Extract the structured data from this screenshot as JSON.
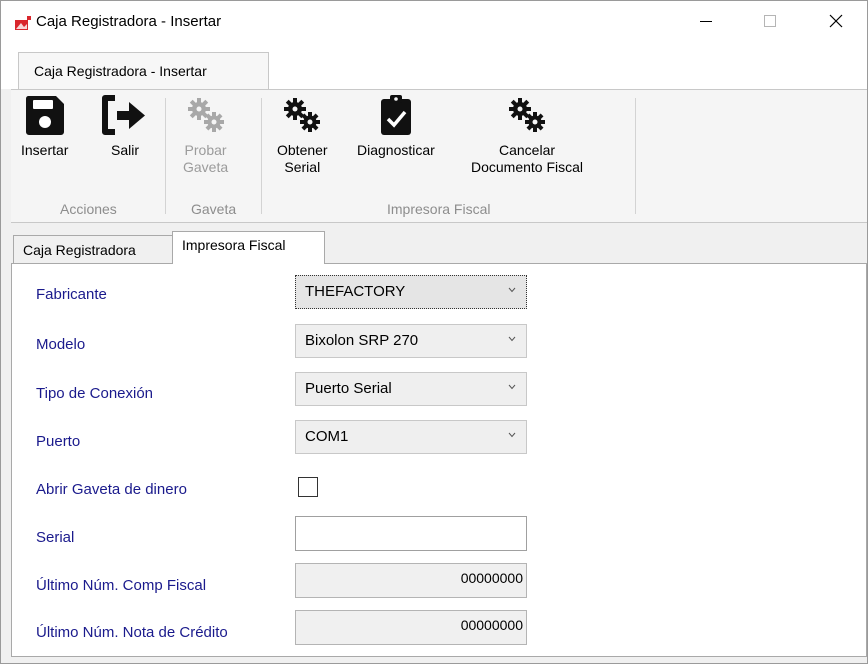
{
  "window": {
    "title": "Caja Registradora - Insertar",
    "controls": {
      "minimize_icon": "minimize-icon",
      "maximize_icon": "maximize-icon",
      "close_icon": "close-icon"
    }
  },
  "ribbon": {
    "tab_label": "Caja Registradora - Insertar",
    "buttons": [
      {
        "label": "Insertar",
        "icon": "save-icon",
        "enabled": true
      },
      {
        "label": "Salir",
        "icon": "exit-icon",
        "enabled": true
      },
      {
        "label_line1": "Probar",
        "label_line2": "Gaveta",
        "icon": "gears-icon",
        "enabled": false
      },
      {
        "label_line1": "Obtener",
        "label_line2": "Serial",
        "icon": "gears-icon",
        "enabled": true
      },
      {
        "label": "Diagnosticar",
        "icon": "clipboard-check-icon",
        "enabled": true
      },
      {
        "label_line1": "Cancelar",
        "label_line2": "Documento Fiscal",
        "icon": "gears-icon",
        "enabled": true
      }
    ],
    "groups": {
      "acciones": "Acciones",
      "gaveta": "Gaveta",
      "impresora": "Impresora Fiscal"
    }
  },
  "tabs": {
    "caja": "Caja Registradora",
    "impresora": "Impresora Fiscal",
    "active": "Impresora Fiscal"
  },
  "form": {
    "fabricante": {
      "label": "Fabricante",
      "value": "THEFACTORY"
    },
    "modelo": {
      "label": "Modelo",
      "value": "Bixolon SRP 270"
    },
    "tipo_conexion": {
      "label": "Tipo de Conexión",
      "value": "Puerto Serial"
    },
    "puerto": {
      "label": "Puerto",
      "value": "COM1"
    },
    "abrir_gaveta": {
      "label": "Abrir Gaveta de dinero",
      "checked": false
    },
    "serial": {
      "label": "Serial",
      "value": ""
    },
    "ultimo_comp": {
      "label": "Último Núm. Comp Fiscal",
      "value": "00000000"
    },
    "ultimo_nota": {
      "label": "Último Núm. Nota de Crédito",
      "value": "00000000"
    }
  },
  "colors": {
    "label_text": "#1a1a8c",
    "disabled_text": "#9b9b9b",
    "app_icon_red": "#d9262c"
  }
}
